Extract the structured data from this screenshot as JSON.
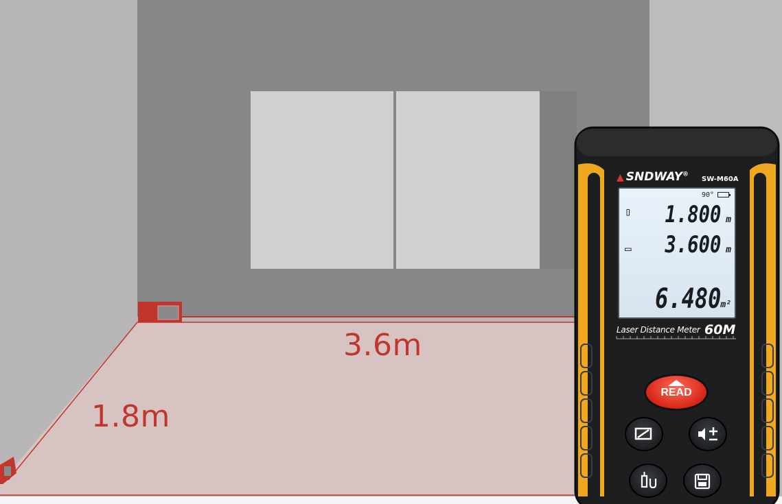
{
  "dimensions": {
    "width_label": "3.6m",
    "depth_label": "1.8m"
  },
  "device": {
    "brand": "SNDWAY",
    "brand_reg": "®",
    "model": "SW-M60A",
    "display": {
      "angle": "90°",
      "value_1": "1.800",
      "unit_1": "m",
      "value_2": "3.600",
      "unit_2": "m",
      "value_3": "6.480",
      "unit_3": "m²"
    },
    "subtitle": "Laser Distance Meter",
    "range": "60M",
    "read_label": "READ",
    "icons": [
      "area-mode-icon",
      "sound-plus-minus-icon",
      "reference-point-icon",
      "save-icon"
    ]
  },
  "colors": {
    "accent_red": "#c0362c",
    "device_yellow": "#f0a820",
    "device_body": "#1c1e20"
  }
}
